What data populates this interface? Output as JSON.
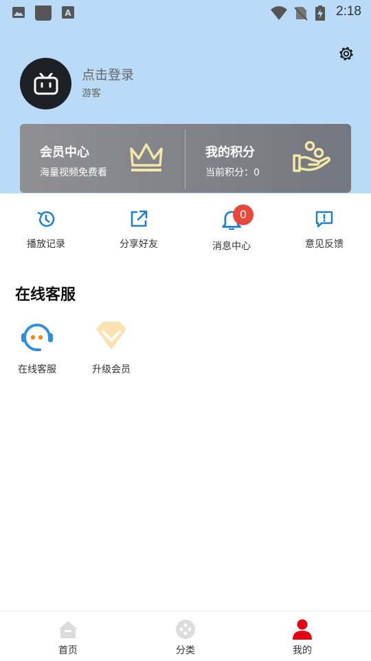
{
  "status_bar": {
    "time": "2:18"
  },
  "profile": {
    "login_text": "点击登录",
    "user_type": "游客"
  },
  "vip": {
    "member_title": "会员中心",
    "member_subtitle": "海量视频免费看",
    "points_title": "我的积分",
    "points_label": "当前积分：",
    "points_value": "0",
    "icon_color": "#f3e8a8"
  },
  "shortcuts": [
    {
      "label": "播放记录",
      "icon": "history-icon"
    },
    {
      "label": "分享好友",
      "icon": "share-icon"
    },
    {
      "label": "消息中心",
      "icon": "bell-icon",
      "badge": "0"
    },
    {
      "label": "意见反馈",
      "icon": "feedback-icon"
    }
  ],
  "services": {
    "title": "在线客服",
    "items": [
      {
        "label": "在线客服",
        "icon": "headset-icon"
      },
      {
        "label": "升级会员",
        "icon": "diamond-icon"
      }
    ]
  },
  "tabbar": {
    "items": [
      {
        "label": "首页",
        "icon": "home-icon",
        "active": false
      },
      {
        "label": "分类",
        "icon": "category-icon",
        "active": false
      },
      {
        "label": "我的",
        "icon": "user-icon",
        "active": true
      }
    ]
  },
  "colors": {
    "header_bg": "#b9dbf7",
    "accent_blue": "#1f7fd0",
    "badge_red": "#e8473b",
    "active_tab": "#e60012",
    "inactive_tab_icon": "#dcdcdc"
  }
}
